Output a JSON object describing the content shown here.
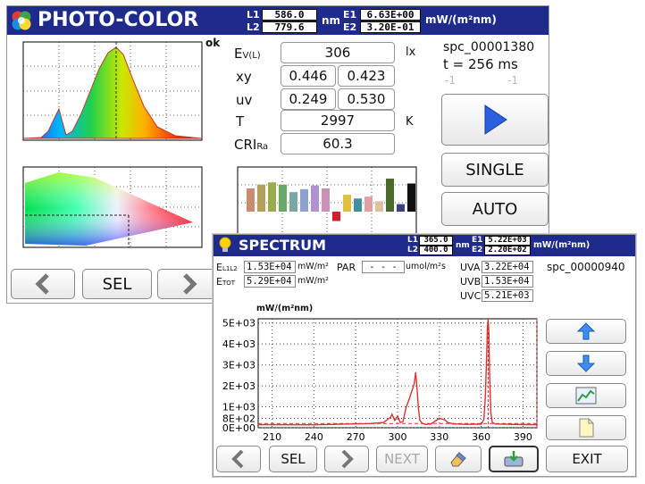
{
  "colors": {
    "title_bar": "#1f2b8c",
    "play_blue": "#2a5fe0",
    "curve_red": "#e23030"
  },
  "photo_window": {
    "title": "PHOTO-COLOR",
    "icon": "color-wheel-icon",
    "header": {
      "l1_label": "L1",
      "l1": "586.0",
      "l2_label": "L2",
      "l2": "779.6",
      "nm": "nm",
      "e1_label": "E1",
      "e1": "6.63E+00",
      "e2_label": "E2",
      "e2": "3.20E-01",
      "unit": "mW/(m²nm)"
    },
    "status": "ok",
    "measurements": {
      "ev_label": "E",
      "ev_sub": "V(L)",
      "ev_value": "306",
      "ev_unit": "lx",
      "xy_label": "xy",
      "x": "0.446",
      "y": "0.423",
      "uv_label": "uv",
      "u": "0.249",
      "v": "0.530",
      "t_label": "T",
      "t_value": "2997",
      "t_unit": "K",
      "cri_label": "CRI",
      "cri_sub": "Ra",
      "cri_value": "60.3"
    },
    "file": {
      "name": "spc_00001380",
      "time": "t = 256 ms",
      "code1": "-1",
      "code2": "-1"
    },
    "buttons": {
      "single": "SINGLE",
      "auto": "AUTO",
      "sel": "SEL"
    },
    "cri_bars": [
      0.62,
      0.72,
      0.78,
      0.72,
      0.52,
      0.6,
      0.7,
      0.62,
      -0.25,
      0.45,
      0.35,
      0.4,
      0.28,
      0.88,
      0.2,
      0.75
    ]
  },
  "spectrum_window": {
    "title": "SPECTRUM",
    "icon": "bulb-icon",
    "header": {
      "l1_label": "L1",
      "l1": "365.0",
      "l2_label": "L2",
      "l2": "400.0",
      "nm": "nm",
      "e1_label": "E1",
      "e1": "5.22E+03",
      "e2_label": "E2",
      "e2": "2.20E+02",
      "unit": "mW/(m²nm)"
    },
    "stats": {
      "el1l2_label": "E",
      "el1l2_sub": "L1L2",
      "el1l2": "1.53E+04",
      "el1l2_unit": "mW/m²",
      "etot_label": "E",
      "etot_sub": "TOT",
      "etot": "5.29E+04",
      "etot_unit": "mW/m²",
      "par_label": "PAR",
      "par_value": "- - -",
      "par_unit": "umol/m²s",
      "uva_label": "UVA",
      "uva": "3.22E+04",
      "uvb_label": "UVB",
      "uvb": "1.53E+04",
      "uvc_label": "UVC",
      "uvc": "5.21E+03",
      "file": "spc_00000940"
    },
    "buttons": {
      "sel": "SEL",
      "next": "NEXT",
      "exit": "EXIT"
    }
  },
  "chart_data": {
    "type": "line",
    "ylabel": "mW/(m²nm)",
    "xlim": [
      200,
      400
    ],
    "ylim": [
      0,
      5200
    ],
    "yticks": [
      "5E+03",
      "4E+03",
      "3E+03",
      "2E+03",
      "1E+03",
      "8E+02",
      "0E+00"
    ],
    "xticks": [
      "210",
      "240",
      "270",
      "300",
      "330",
      "360",
      "390"
    ],
    "x": [
      200,
      240,
      280,
      290,
      295,
      296,
      298,
      300,
      302,
      304,
      306,
      308,
      310,
      312,
      313,
      314,
      315,
      316,
      318,
      320,
      324,
      330,
      334,
      336,
      340,
      350,
      360,
      362,
      363,
      364,
      364.5,
      365,
      365.5,
      366,
      367,
      368,
      370,
      380,
      390,
      400
    ],
    "y": [
      150,
      140,
      200,
      250,
      500,
      650,
      350,
      560,
      250,
      300,
      950,
      1300,
      1700,
      2100,
      2650,
      1900,
      900,
      350,
      200,
      160,
      180,
      450,
      380,
      250,
      180,
      160,
      170,
      400,
      1500,
      3500,
      4800,
      5150,
      4600,
      2600,
      700,
      250,
      180,
      160,
      150,
      150
    ],
    "markers": [
      365.0,
      400.0
    ]
  }
}
